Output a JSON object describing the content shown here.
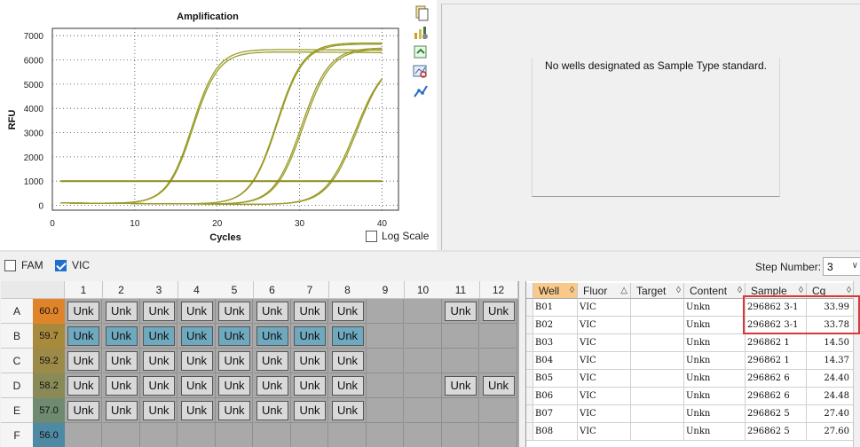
{
  "chart_data": {
    "type": "line",
    "title": "Amplification",
    "xlabel": "Cycles",
    "ylabel": "RFU",
    "xlim": [
      0,
      42
    ],
    "ylim": [
      -200,
      7300
    ],
    "xticks": [
      0,
      10,
      20,
      30,
      40
    ],
    "yticks": [
      0,
      1000,
      2000,
      3000,
      4000,
      5000,
      6000,
      7000
    ],
    "threshold": 1000,
    "grid": true,
    "log_scale": false,
    "line_color": "#9a9a28",
    "threshold_color": "#8a8a1a",
    "series": [
      {
        "ct": 14.5,
        "plateau": 6300,
        "k": 0.65
      },
      {
        "ct": 14.37,
        "plateau": 6400,
        "k": 0.65
      },
      {
        "ct": 24.4,
        "plateau": 6700,
        "k": 0.62
      },
      {
        "ct": 24.48,
        "plateau": 6650,
        "k": 0.62
      },
      {
        "ct": 27.4,
        "plateau": 6500,
        "k": 0.6
      },
      {
        "ct": 27.6,
        "plateau": 6450,
        "k": 0.6
      },
      {
        "ct": 33.99,
        "plateau": 6200,
        "k": 0.55
      },
      {
        "ct": 33.78,
        "plateau": 6100,
        "k": 0.55
      }
    ]
  },
  "chart_panel": {
    "log_scale_label": "Log Scale",
    "icons": [
      "copy-icon",
      "chart-settings-icon",
      "export-icon",
      "zoom-chart-icon",
      "trace-icon"
    ]
  },
  "standard_panel": {
    "message": "No wells designated as Sample Type standard."
  },
  "fluor_filters": [
    {
      "label": "FAM",
      "checked": false
    },
    {
      "label": "VIC",
      "checked": true
    }
  ],
  "step": {
    "label": "Step Number:",
    "value": "3"
  },
  "plate": {
    "columns": [
      "1",
      "2",
      "3",
      "4",
      "5",
      "6",
      "7",
      "8",
      "9",
      "10",
      "11",
      "12"
    ],
    "rows": [
      {
        "row": "A",
        "temp": "60.0",
        "temp_color": "#e0842a",
        "wells": [
          "Unk",
          "Unk",
          "Unk",
          "Unk",
          "Unk",
          "Unk",
          "Unk",
          "Unk",
          "",
          "",
          "Unk",
          "Unk"
        ],
        "selected": false
      },
      {
        "row": "B",
        "temp": "59.7",
        "temp_color": "#a88a3c",
        "wells": [
          "Unk",
          "Unk",
          "Unk",
          "Unk",
          "Unk",
          "Unk",
          "Unk",
          "Unk",
          "",
          "",
          "",
          ""
        ],
        "selected": true
      },
      {
        "row": "C",
        "temp": "59.2",
        "temp_color": "#9c8a48",
        "wells": [
          "Unk",
          "Unk",
          "Unk",
          "Unk",
          "Unk",
          "Unk",
          "Unk",
          "Unk",
          "",
          "",
          "",
          ""
        ],
        "selected": false
      },
      {
        "row": "D",
        "temp": "58.2",
        "temp_color": "#8a8a58",
        "wells": [
          "Unk",
          "Unk",
          "Unk",
          "Unk",
          "Unk",
          "Unk",
          "Unk",
          "Unk",
          "",
          "",
          "Unk",
          "Unk"
        ],
        "selected": false
      },
      {
        "row": "E",
        "temp": "57.0",
        "temp_color": "#6e8a70",
        "wells": [
          "Unk",
          "Unk",
          "Unk",
          "Unk",
          "Unk",
          "Unk",
          "Unk",
          "Unk",
          "",
          "",
          "",
          ""
        ],
        "selected": false
      },
      {
        "row": "F",
        "temp": "56.0",
        "temp_color": "#4f8aa4",
        "wells": [
          "",
          "",
          "",
          "",
          "",
          "",
          "",
          "",
          "",
          "",
          "",
          ""
        ],
        "selected": false
      }
    ]
  },
  "table": {
    "columns": [
      {
        "label": "Well",
        "sort": "◊"
      },
      {
        "label": "Fluor",
        "sort": "△"
      },
      {
        "label": "Target",
        "sort": "◊"
      },
      {
        "label": "Content",
        "sort": "◊"
      },
      {
        "label": "Sample",
        "sort": "◊"
      },
      {
        "label": "Cq",
        "sort": "◊"
      }
    ],
    "rows": [
      [
        "B01",
        "VIC",
        "",
        "Unkn",
        "296862 3-1",
        "33.99"
      ],
      [
        "B02",
        "VIC",
        "",
        "Unkn",
        "296862 3-1",
        "33.78"
      ],
      [
        "B03",
        "VIC",
        "",
        "Unkn",
        "296862 1",
        "14.50"
      ],
      [
        "B04",
        "VIC",
        "",
        "Unkn",
        "296862 1",
        "14.37"
      ],
      [
        "B05",
        "VIC",
        "",
        "Unkn",
        "296862 6",
        "24.40"
      ],
      [
        "B06",
        "VIC",
        "",
        "Unkn",
        "296862 6",
        "24.48"
      ],
      [
        "B07",
        "VIC",
        "",
        "Unkn",
        "296862 5",
        "27.40"
      ],
      [
        "B08",
        "VIC",
        "",
        "Unkn",
        "296862 5",
        "27.60"
      ]
    ]
  }
}
